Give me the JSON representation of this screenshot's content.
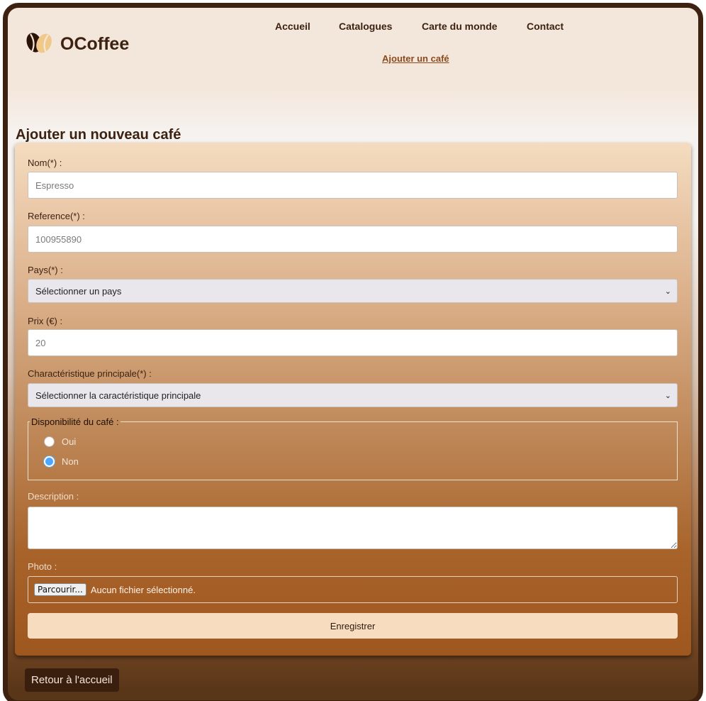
{
  "header": {
    "logo_text": "OCoffee",
    "nav": [
      "Accueil",
      "Catalogues",
      "Carte du monde",
      "Contact"
    ],
    "active_link": "Ajouter un café"
  },
  "page": {
    "title": "Ajouter un nouveau café"
  },
  "form": {
    "name": {
      "label": "Nom(*) :",
      "placeholder": "Espresso"
    },
    "reference": {
      "label": "Reference(*) :",
      "placeholder": "100955890"
    },
    "country": {
      "label": "Pays(*) :",
      "selected": "Sélectionner un pays"
    },
    "price": {
      "label": "Prix (€) :",
      "placeholder": "20"
    },
    "characteristic": {
      "label": "Charactéristique principale(*) :",
      "selected": "Sélectionner la caractéristique principale"
    },
    "availability": {
      "legend": "Disponibilité du café :",
      "options": [
        "Oui",
        "Non"
      ],
      "selected": "Non"
    },
    "description": {
      "label": "Description :"
    },
    "photo": {
      "label": "Photo :",
      "button": "Parcourir...",
      "status": "Aucun fichier sélectionné."
    },
    "submit_label": "Enregistrer"
  },
  "footer": {
    "back_label": "Retour à l'accueil"
  },
  "colors": {
    "brand_dark": "#3d2212",
    "link_active": "#8a4a1c",
    "button_light": "#f8dcc0"
  }
}
